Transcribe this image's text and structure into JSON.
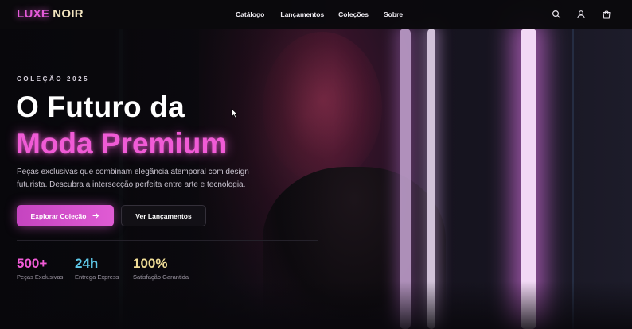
{
  "colors": {
    "accent_pink": "#f05bd6",
    "accent_cyan": "#5ec8e8",
    "accent_gold": "#f0dc96",
    "logo_cream": "#f2e4bf",
    "background": "#08070b"
  },
  "header": {
    "logo_part1": "LUXE",
    "logo_part2": "NOIR",
    "nav": [
      {
        "label": "Catálogo"
      },
      {
        "label": "Lançamentos"
      },
      {
        "label": "Coleções"
      },
      {
        "label": "Sobre"
      }
    ],
    "icons": [
      "search-icon",
      "user-icon",
      "shopping-bag-icon"
    ]
  },
  "hero": {
    "eyebrow": "COLEÇÃO 2025",
    "title_line1": "O Futuro da",
    "title_line2": "Moda Premium",
    "description_line1": "Peças exclusivas que combinam elegância atemporal com design",
    "description_line2": "futurista. Descubra a intersecção perfeita entre arte e tecnologia.",
    "primary_button": "Explorar Coleção",
    "primary_button_icon": "arrow-right-icon",
    "secondary_button": "Ver Lançamentos"
  },
  "stats": [
    {
      "value": "500+",
      "label": "Peças Exclusivas",
      "color": "#f05bd6"
    },
    {
      "value": "24h",
      "label": "Entrega Express",
      "color": "#5ec8e8"
    },
    {
      "value": "100%",
      "label": "Satisfação Garantida",
      "color": "#f0dc96"
    }
  ]
}
